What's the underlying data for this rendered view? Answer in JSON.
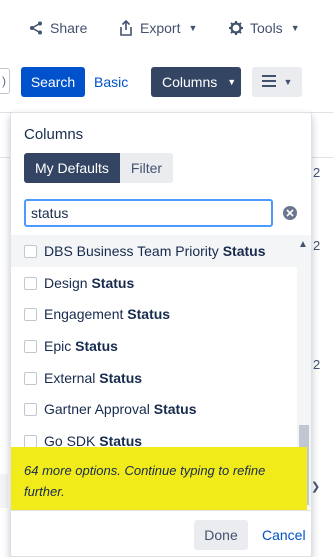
{
  "toolbar": {
    "share_label": "Share",
    "export_label": "Export",
    "tools_label": "Tools"
  },
  "search_bar": {
    "search_label": "Search",
    "basic_label": "Basic",
    "columns_label": "Columns",
    "left_field_glyph": ")"
  },
  "background_rows": {
    "numbers": [
      "2",
      "2",
      "2"
    ]
  },
  "columns_panel": {
    "title": "Columns",
    "tabs": [
      {
        "label": "My Defaults",
        "active": true
      },
      {
        "label": "Filter",
        "active": false
      }
    ],
    "filter_value": "status",
    "options": [
      {
        "prefix": "DBS Business Team Priority ",
        "match": "Status",
        "checked": false
      },
      {
        "prefix": "Design ",
        "match": "Status",
        "checked": false
      },
      {
        "prefix": "Engagement ",
        "match": "Status",
        "checked": false
      },
      {
        "prefix": "Epic ",
        "match": "Status",
        "checked": false
      },
      {
        "prefix": "External ",
        "match": "Status",
        "checked": false
      },
      {
        "prefix": "Gartner Approval ",
        "match": "Status",
        "checked": false
      },
      {
        "prefix": "Go SDK ",
        "match": "Status",
        "checked": false
      }
    ],
    "more_options_note": "64 more options. Continue typing to refine further.",
    "done_label": "Done",
    "cancel_label": "Cancel"
  },
  "colors": {
    "primary_button": "#0052cc",
    "dark_button": "#344563",
    "highlight": "#f2eb1a",
    "focus_border": "#4c9aff"
  }
}
